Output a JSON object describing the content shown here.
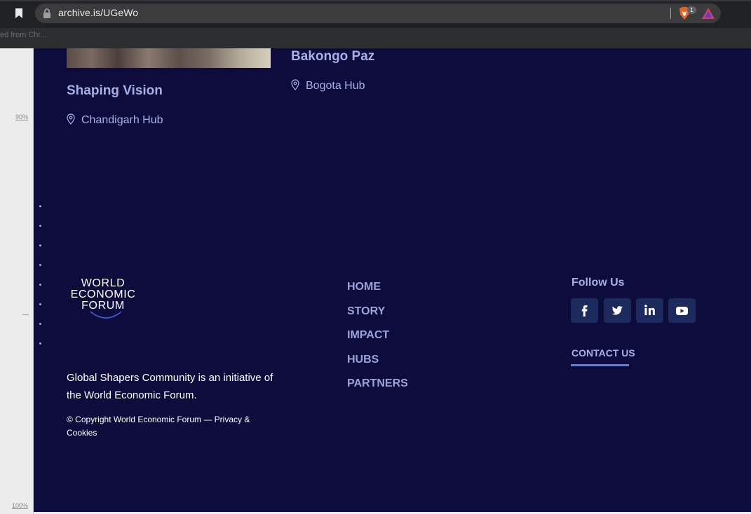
{
  "browser": {
    "url": "archive.is/UGeWo",
    "bookmark_bar_text": "ed from Chr...",
    "brave_badge_count": "1"
  },
  "ruler": {
    "label_90": "90%",
    "label_100": "100%"
  },
  "cards": [
    {
      "title": "Shaping Vision",
      "hub": "Chandigarh Hub"
    },
    {
      "title": "Bakongo Paz",
      "hub": "Bogota Hub"
    }
  ],
  "footer": {
    "logo": {
      "line1": "WORLD",
      "line2": "ECONOMIC",
      "line3": "FORUM"
    },
    "description": "Global Shapers Community is an initiative of the World Economic Forum.",
    "copyright": "© Copyright World Economic Forum — Privacy & Cookies",
    "nav": [
      "HOME",
      "STORY",
      "IMPACT",
      "HUBS",
      "PARTNERS"
    ],
    "follow_label": "Follow Us",
    "social": [
      "facebook-icon",
      "twitter-icon",
      "linkedin-icon",
      "youtube-icon"
    ],
    "contact_label": "CONTACT US"
  },
  "colors": {
    "page_bg": "#0e0c3d",
    "accent_text": "#a7b0e6",
    "nav_text": "#9aa4dc",
    "social_bg": "#1c2a5e"
  }
}
